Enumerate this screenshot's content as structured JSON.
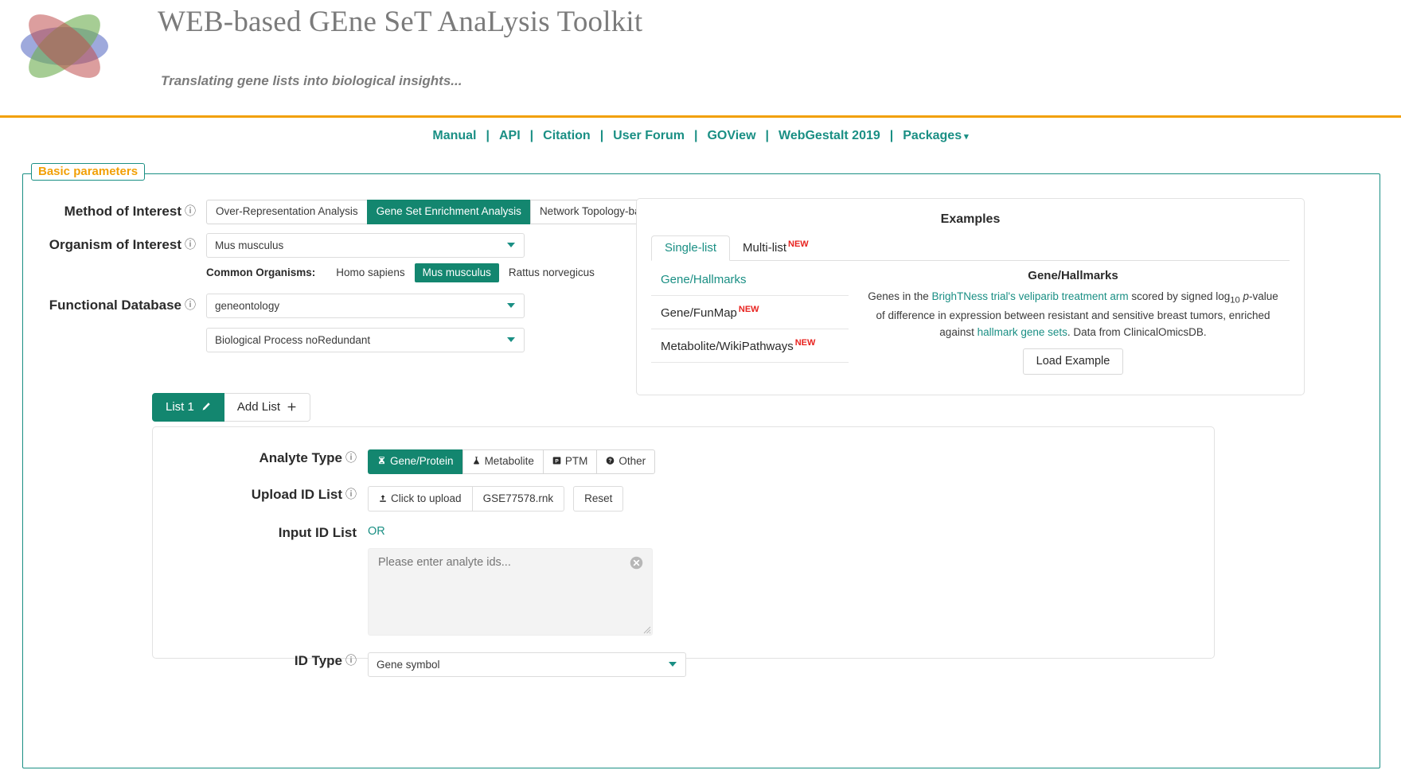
{
  "header": {
    "logo_icon": "webgestalt-flower-logo",
    "title": "WEB-based GEne SeT AnaLysis Toolkit",
    "tagline": "Translating gene lists into biological insights..."
  },
  "nav": {
    "items": [
      {
        "label": "Manual"
      },
      {
        "label": "API"
      },
      {
        "label": "Citation"
      },
      {
        "label": "User Forum"
      },
      {
        "label": "GOView"
      },
      {
        "label": "WebGestalt 2019"
      },
      {
        "label": "Packages"
      }
    ],
    "separator": "|",
    "caret": "▾"
  },
  "basic_parameters": {
    "legend": "Basic parameters",
    "method": {
      "label": "Method of Interest",
      "help": "?",
      "options": [
        "Over-Representation Analysis",
        "Gene Set Enrichment Analysis",
        "Network Topology-based Analysis"
      ],
      "selected": "Gene Set Enrichment Analysis"
    },
    "organism": {
      "label": "Organism of Interest",
      "help": "?",
      "selected": "Mus musculus",
      "common_label": "Common Organisms:",
      "common_options": [
        "Homo sapiens",
        "Mus musculus",
        "Rattus norvegicus"
      ],
      "common_selected": "Mus musculus"
    },
    "database": {
      "label": "Functional Database",
      "help": "?",
      "selected": "geneontology",
      "sub_selected": "Biological Process noRedundant"
    }
  },
  "examples": {
    "title": "Examples",
    "tabs": [
      {
        "label": "Single-list",
        "badge": ""
      },
      {
        "label": "Multi-list",
        "badge": "NEW"
      }
    ],
    "active_tab": "Single-list",
    "items": [
      {
        "label": "Gene/Hallmarks",
        "badge": ""
      },
      {
        "label": "Gene/FunMap",
        "badge": "NEW"
      },
      {
        "label": "Metabolite/WikiPathways",
        "badge": "NEW"
      }
    ],
    "active_item": "Gene/Hallmarks",
    "detail": {
      "title": "Gene/Hallmarks",
      "text_1": "Genes in the ",
      "link_1": "BrighTNess trial's veliparib treatment arm",
      "text_2": " scored by signed log",
      "sub_10": "10",
      "text_3": " ",
      "italic_p": "p",
      "text_4": "-value of difference in expression between resistant and sensitive breast tumors, enriched against ",
      "link_2": "hallmark gene sets",
      "text_5": ". Data from ClinicalOmicsDB.",
      "button": "Load Example"
    }
  },
  "list_tabs": {
    "items": [
      {
        "label": "List 1",
        "icon": "pencil-icon",
        "active": true
      },
      {
        "label": "Add List",
        "icon": "plus-icon",
        "active": false
      }
    ]
  },
  "list_form": {
    "analyte_type": {
      "label": "Analyte Type",
      "help": "?",
      "options": [
        {
          "label": "Gene/Protein",
          "icon": "dna-icon"
        },
        {
          "label": "Metabolite",
          "icon": "flask-icon"
        },
        {
          "label": "PTM",
          "icon": "ptm-box-icon"
        },
        {
          "label": "Other",
          "icon": "question-circle-icon"
        }
      ],
      "selected": "Gene/Protein"
    },
    "upload": {
      "label": "Upload ID List",
      "help": "?",
      "upload_button": "Click to upload",
      "upload_icon": "upload-arrow-icon",
      "filename": "GSE77578.rnk",
      "reset_button": "Reset"
    },
    "input_list": {
      "label": "Input ID List",
      "or": "OR",
      "placeholder": "Please enter analyte ids...",
      "value": "",
      "clear_icon": "clear-circle-x-icon"
    },
    "id_type": {
      "label": "ID Type",
      "help": "?",
      "selected": "Gene symbol"
    }
  },
  "colors": {
    "teal": "#13866f",
    "teal_link": "#1a8f84",
    "orange": "#f2a007",
    "red_badge": "#e8231f",
    "title_gray": "#7b7b7b"
  }
}
